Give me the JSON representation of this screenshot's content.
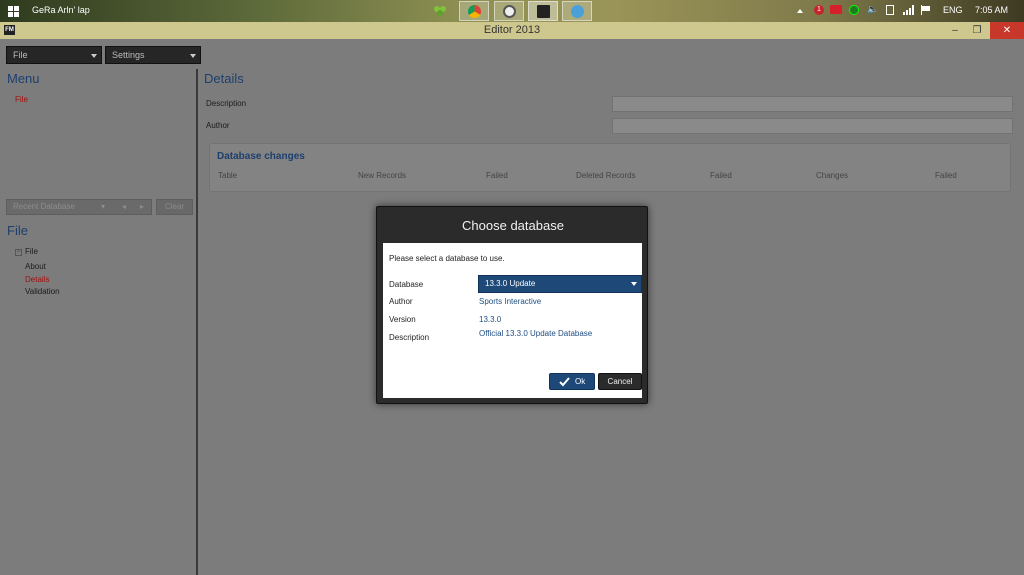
{
  "taskbar": {
    "user": "GeRa Arln' lap",
    "language": "ENG",
    "time": "7:05 AM",
    "notification_count": "1",
    "apps": [
      "clover-icon",
      "chrome-icon",
      "app-icon",
      "editor-icon",
      "browser-icon"
    ]
  },
  "window": {
    "icon_text": "FM",
    "title": "Editor 2013",
    "minimize": "–",
    "maximize": "❐",
    "close": "✕"
  },
  "toolbar": {
    "file_dropdown": "File",
    "settings_dropdown": "Settings"
  },
  "menu": {
    "heading": "Menu",
    "items": [
      "File"
    ]
  },
  "recent": {
    "placeholder": "Recent Database",
    "prev": "◂",
    "next": "▸",
    "clear": "Clear"
  },
  "file_section": {
    "heading": "File",
    "root": "File",
    "children": [
      "About",
      "Details",
      "Validation"
    ]
  },
  "details": {
    "heading": "Details",
    "description_label": "Description",
    "author_label": "Author",
    "changes_title": "Database changes",
    "columns": [
      "Table",
      "New Records",
      "Failed",
      "Deleted Records",
      "Failed",
      "Changes",
      "Failed"
    ]
  },
  "modal": {
    "title": "Choose database",
    "prompt": "Please select a database to use.",
    "database_label": "Database",
    "database_value": "13.3.0 Update",
    "author_label": "Author",
    "author_value": "Sports Interactive",
    "version_label": "Version",
    "version_value": "13.3.0",
    "description_label": "Description",
    "description_value": "Official 13.3.0 Update Database",
    "ok": "Ok",
    "cancel": "Cancel"
  }
}
